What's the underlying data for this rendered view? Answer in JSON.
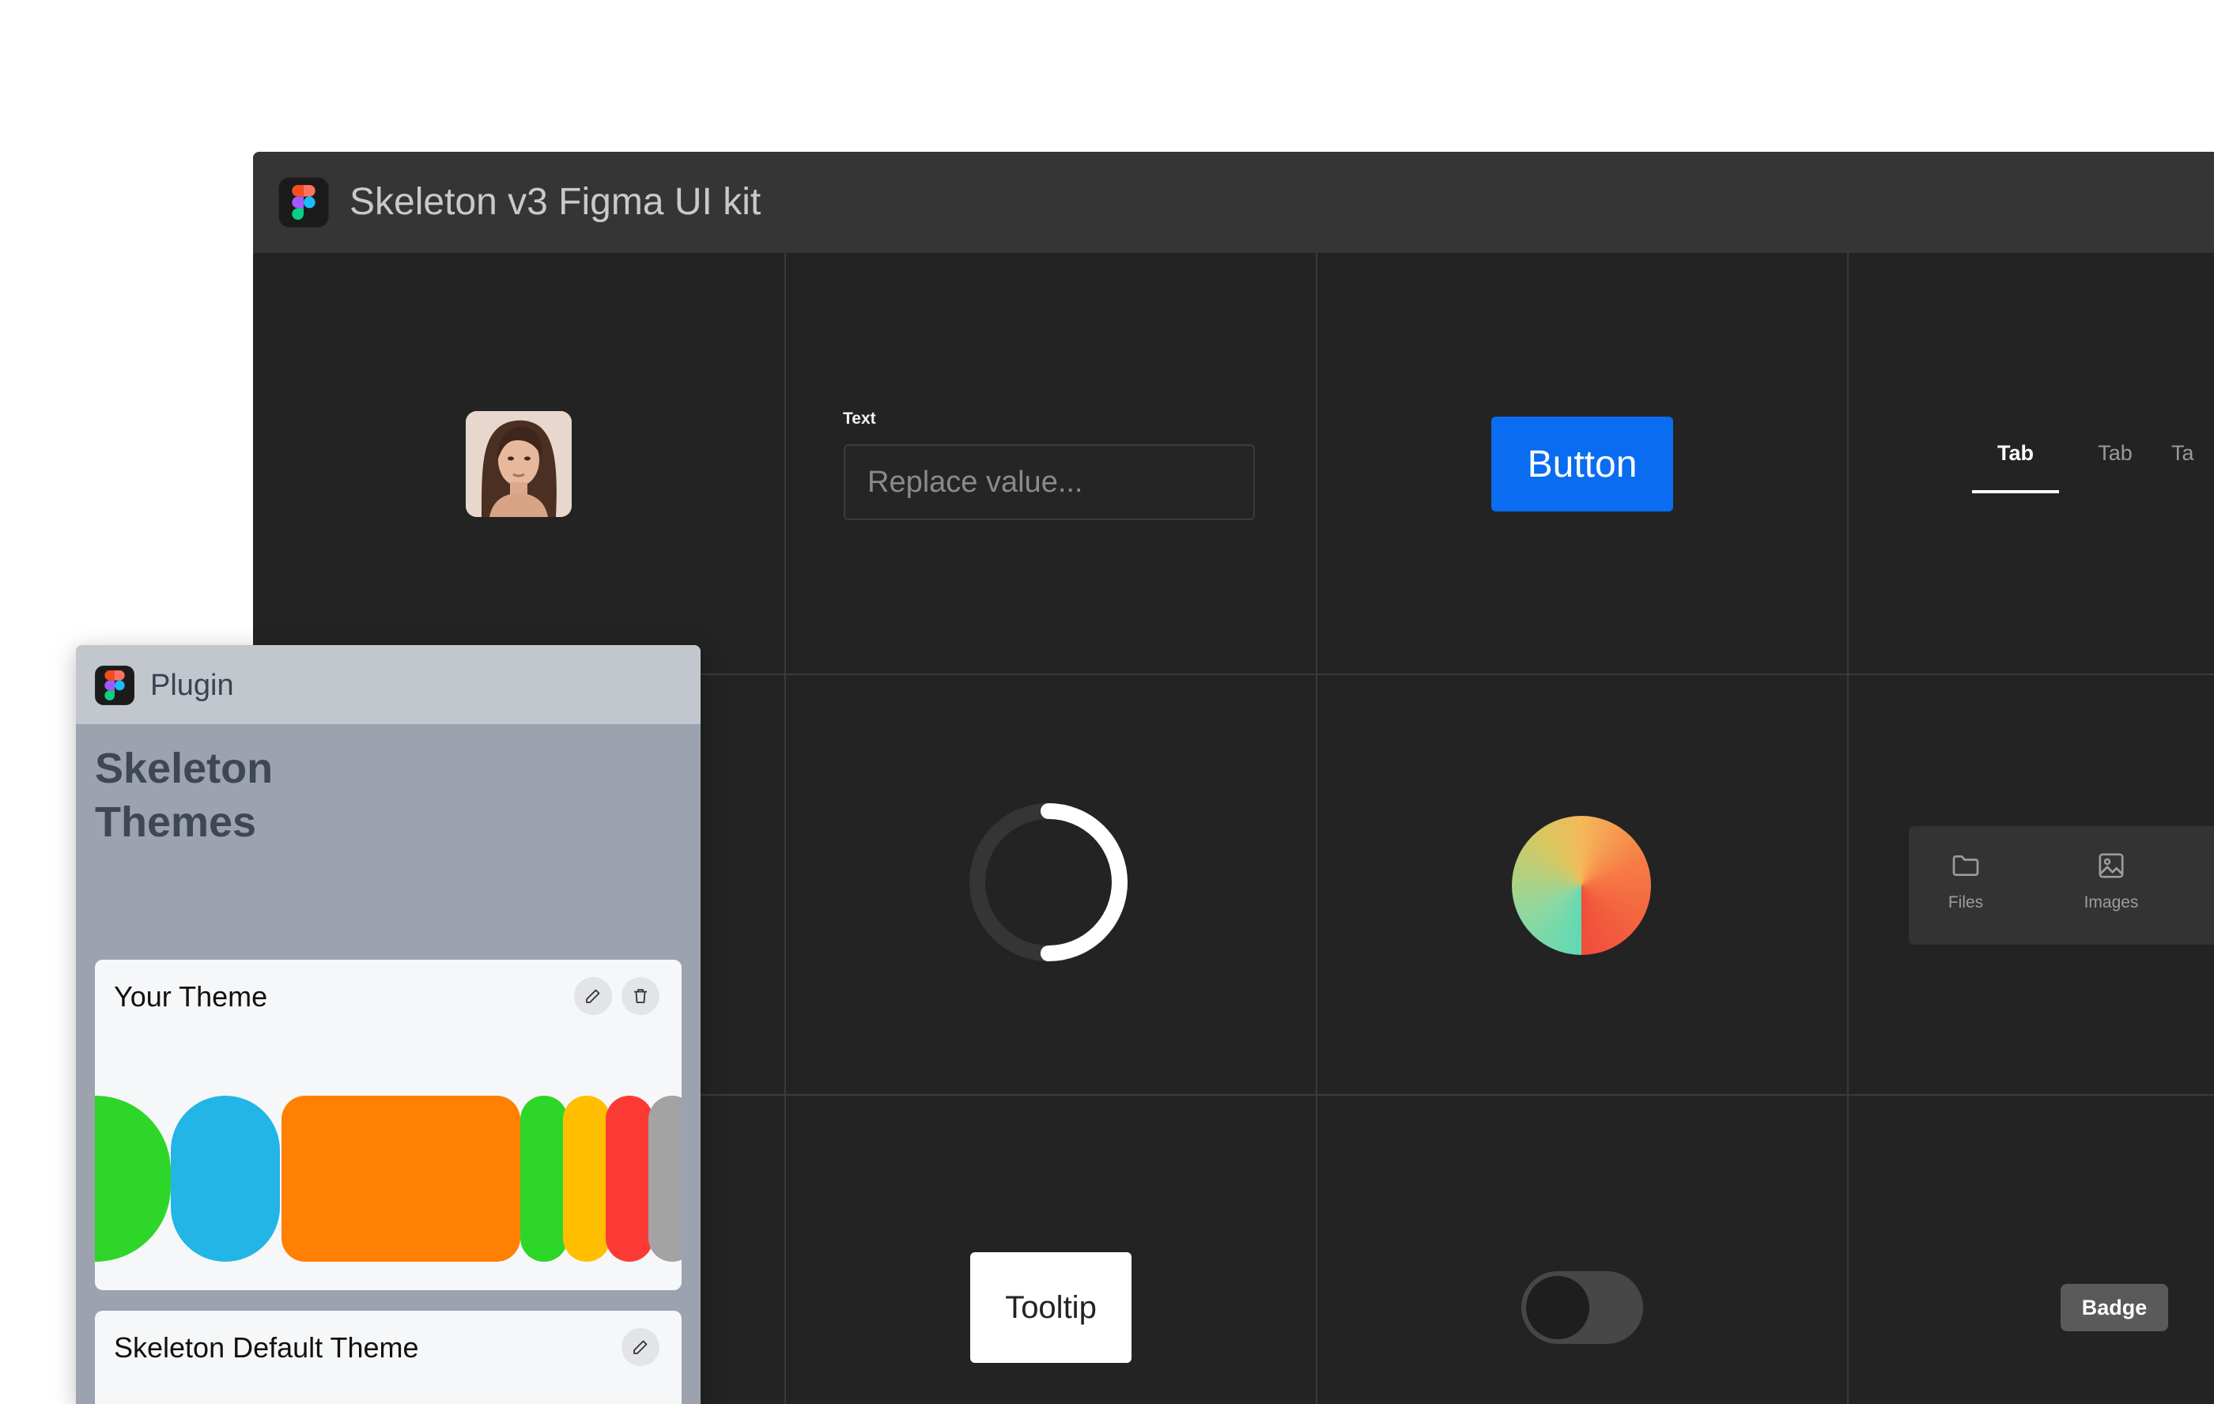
{
  "window": {
    "title": "Skeleton v3 Figma UI kit"
  },
  "components": {
    "input": {
      "label": "Text",
      "placeholder": "Replace value..."
    },
    "button": {
      "label": "Button"
    },
    "tabs": [
      {
        "label": "Tab",
        "active": true
      },
      {
        "label": "Tab",
        "active": false
      },
      {
        "label": "Ta",
        "active": false
      }
    ],
    "nav": [
      {
        "label": "Files",
        "icon": "folder-icon"
      },
      {
        "label": "Images",
        "icon": "image-icon"
      }
    ],
    "tooltip": {
      "label": "Tooltip"
    },
    "toggle": {
      "checked": false
    },
    "badge": {
      "label": "Badge"
    },
    "progress_ring": {
      "progress": 0.5
    }
  },
  "plugin": {
    "title": "Plugin",
    "heading_line1": "Skeleton",
    "heading_line2": "Themes",
    "themes": [
      {
        "name": "Your Theme",
        "actions": [
          "edit-icon",
          "trash-icon"
        ],
        "swatches": [
          "#2fd62a",
          "#22b5e6",
          "#ff8003",
          "#2fd62a",
          "#ffbf00",
          "#fb3a36",
          "#a3a3a3"
        ]
      },
      {
        "name": "Skeleton Default Theme",
        "actions": [
          "edit-icon"
        ]
      }
    ]
  },
  "colors": {
    "primary": "#0a6cf0",
    "surface_dark": "#232323",
    "titlebar": "#353535",
    "plugin_bg": "#9ca3af"
  }
}
